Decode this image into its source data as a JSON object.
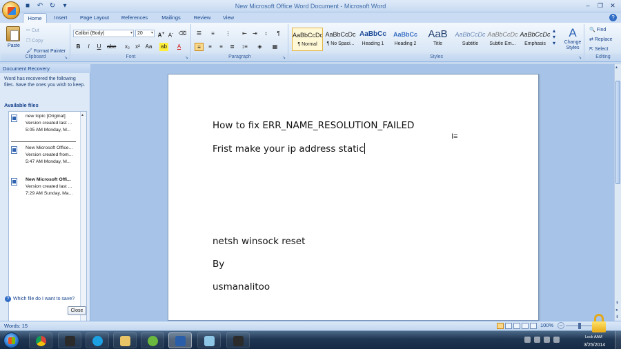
{
  "window": {
    "title": "New Microsoft Office Word Document - Microsoft Word"
  },
  "tabs": [
    "Home",
    "Insert",
    "Page Layout",
    "References",
    "Mailings",
    "Review",
    "View"
  ],
  "clipboard": {
    "paste": "Paste",
    "cut": "Cut",
    "copy": "Copy",
    "format_painter": "Format Painter",
    "label": "Clipboard"
  },
  "font": {
    "name": "Calibri (Body)",
    "size": "20",
    "label": "Font"
  },
  "paragraph": {
    "label": "Paragraph"
  },
  "styles": {
    "label": "Styles",
    "items": [
      {
        "sample": "AaBbCcDc",
        "name": "¶ Normal"
      },
      {
        "sample": "AaBbCcDc",
        "name": "¶ No Spaci..."
      },
      {
        "sample": "AaBbCc",
        "name": "Heading 1"
      },
      {
        "sample": "AaBbCc",
        "name": "Heading 2"
      },
      {
        "sample": "AaB",
        "name": "Title"
      },
      {
        "sample": "AaBbCcDc",
        "name": "Subtitle"
      },
      {
        "sample": "AaBbCcDc",
        "name": "Subtle Em..."
      },
      {
        "sample": "AaBbCcDc",
        "name": "Emphasis"
      }
    ],
    "change_styles": "Change Styles"
  },
  "editing": {
    "find": "Find",
    "replace": "Replace",
    "select": "Select",
    "label": "Editing"
  },
  "recovery": {
    "header": "Document Recovery",
    "message": "Word has recovered the following files.  Save the ones you wish to keep.",
    "available": "Available files",
    "files": [
      {
        "name": "new topic  [Original]",
        "line1": "Version created last ...",
        "line2": "5:05 AM Monday, M..."
      },
      {
        "name": "New Microsoft Office...",
        "line1": "Version created from...",
        "line2": "5:47 AM Monday, M..."
      },
      {
        "name": "New Microsoft Offi...",
        "line1": "Version created last ...",
        "line2": "7:29 AM Sunday, Ma..."
      }
    ],
    "which_file": "Which file do I want to save?",
    "close": "Close"
  },
  "document": {
    "lines": [
      "How to fix ERR_NAME_RESOLUTION_FAILED",
      "Frist make your ip address static",
      "netsh winsock reset",
      "By",
      "usmanalitoo"
    ]
  },
  "status": {
    "words": "Words: 15",
    "zoom": "100%"
  },
  "taskbar": {
    "date": "3/25/2014",
    "lock_label": "Lock AAM"
  },
  "colors": {
    "ribbon_accent": "#15428b",
    "doc_background": "#a7c4e8",
    "taskbar": "#1f3652"
  }
}
